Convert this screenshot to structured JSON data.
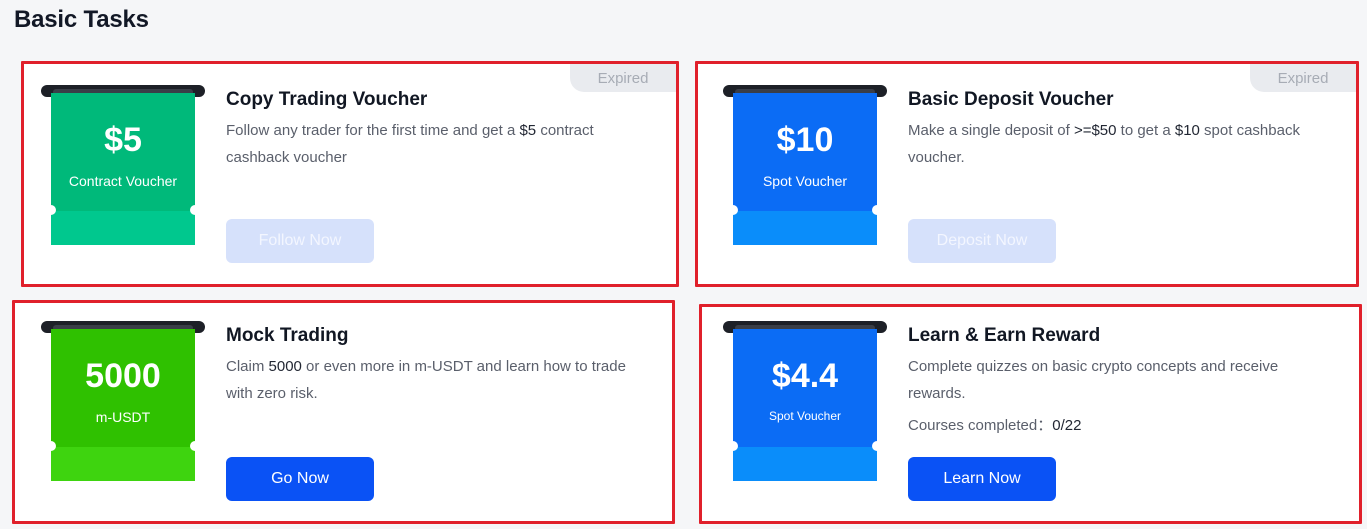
{
  "page": {
    "title": "Basic Tasks"
  },
  "colors": {
    "highlight_border": "#e0202b",
    "green_voucher": "#00b97a",
    "blue_voucher": "#0b6cf5",
    "lime_voucher": "#2fc100",
    "primary_button": "#0a52f5",
    "disabled_button": "#d6e1fb"
  },
  "tasks": [
    {
      "badge": "Expired",
      "voucher": {
        "amount": "$5",
        "label": "Contract Voucher"
      },
      "title": "Copy Trading Voucher",
      "desc": {
        "t1": "Follow any trader for the first time and get a ",
        "v1": "$5",
        "t2": " contract cashback voucher"
      },
      "button": "Follow Now",
      "button_state": "disabled"
    },
    {
      "badge": "Expired",
      "voucher": {
        "amount": "$10",
        "label": "Spot Voucher"
      },
      "title": "Basic Deposit Voucher",
      "desc": {
        "t1": "Make a single deposit of ",
        "v1": ">=$50",
        "t2": " to get a ",
        "v2": "$10",
        "t3": " spot cashback voucher."
      },
      "button": "Deposit Now",
      "button_state": "disabled"
    },
    {
      "voucher": {
        "amount": "5000",
        "label": "m-USDT"
      },
      "title": "Mock Trading",
      "desc": {
        "t1": "Claim ",
        "v1": "5000",
        "t2": " or even more in m-USDT and learn how to trade with zero risk."
      },
      "button": "Go Now",
      "button_state": "active"
    },
    {
      "voucher": {
        "amount": "$4.4",
        "label": "Spot Voucher"
      },
      "title": "Learn & Earn Reward",
      "desc": {
        "t1": "Complete quizzes on basic crypto concepts and receive rewards."
      },
      "progress": {
        "label": "Courses completed：",
        "done": "0",
        "total": "/22"
      },
      "button": "Learn Now",
      "button_state": "active"
    }
  ]
}
